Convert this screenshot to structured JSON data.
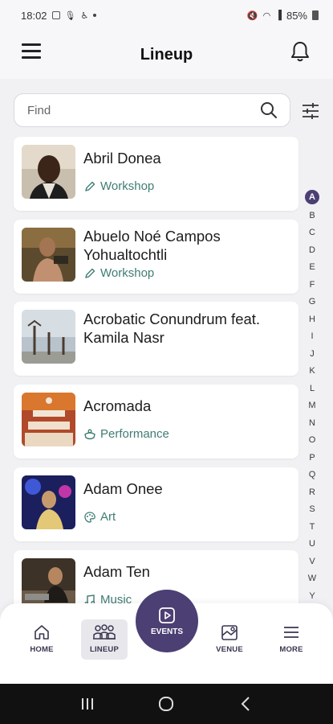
{
  "status_bar": {
    "time": "18:02",
    "battery": "85%"
  },
  "header": {
    "title": "Lineup"
  },
  "search": {
    "placeholder": "Find"
  },
  "lineup": [
    {
      "name": "Abril Donea",
      "tag": "Workshop",
      "tag_icon": "pencil-icon"
    },
    {
      "name": "Abuelo Noé Campos Yohualtochtli",
      "tag": "Workshop",
      "tag_icon": "pencil-icon"
    },
    {
      "name": "Acrobatic Conundrum feat. Kamila Nasr",
      "tag": "",
      "tag_icon": ""
    },
    {
      "name": "Acromada",
      "tag": "Performance",
      "tag_icon": "performance-icon"
    },
    {
      "name": "Adam Onee",
      "tag": "Art",
      "tag_icon": "palette-icon"
    },
    {
      "name": "Adam Ten",
      "tag": "Music",
      "tag_icon": "music-note-icon"
    }
  ],
  "alphabet": [
    "A",
    "B",
    "C",
    "D",
    "E",
    "F",
    "G",
    "H",
    "I",
    "J",
    "K",
    "L",
    "M",
    "N",
    "O",
    "P",
    "Q",
    "R",
    "S",
    "T",
    "U",
    "V",
    "W",
    "Y"
  ],
  "alphabet_active": "A",
  "nav": {
    "home": "HOME",
    "lineup": "LINEUP",
    "events": "EVENTS",
    "venue": "VENUE",
    "more": "MORE"
  },
  "colors": {
    "accent": "#4b3f73",
    "tag": "#3f7d73"
  }
}
